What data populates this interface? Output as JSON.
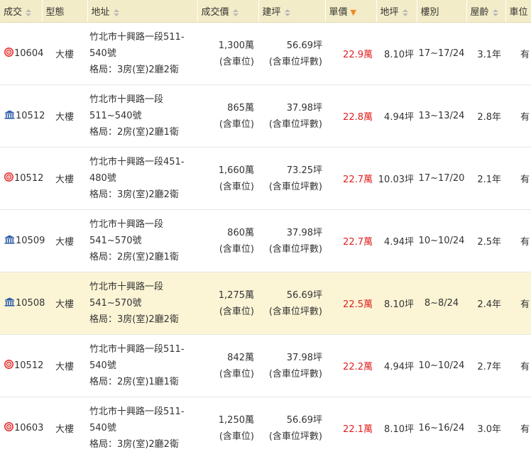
{
  "headers": {
    "date": "成交",
    "type": "型態",
    "addr": "地址",
    "price": "成交價",
    "area": "建坪",
    "unit": "單價",
    "land": "地坪",
    "floor": "樓別",
    "age": "屋齡",
    "parking": "車位"
  },
  "rows": [
    {
      "source": "target-icon",
      "date": "10604",
      "type": "大樓",
      "addr1": "竹北市十興路一段511-",
      "addr2": "540號",
      "layout": "格局：3房(室)2廳2衛",
      "price": "1,300萬",
      "price_note": "(含車位)",
      "area": "56.69坪",
      "area_note": "(含車位坪數)",
      "unit": "22.9萬",
      "land": "8.10坪",
      "floor": "17~17/24",
      "age": "3.1年",
      "parking": "有",
      "highlight": false
    },
    {
      "source": "government-icon",
      "date": "10512",
      "type": "大樓",
      "addr1": "竹北市十興路一段",
      "addr2": "511~540號",
      "layout": "格局：2房(室)2廳1衛",
      "price": "865萬",
      "price_note": "(含車位)",
      "area": "37.98坪",
      "area_note": "(含車位坪數)",
      "unit": "22.8萬",
      "land": "4.94坪",
      "floor": "13~13/24",
      "age": "2.8年",
      "parking": "有",
      "highlight": false
    },
    {
      "source": "target-icon",
      "date": "10512",
      "type": "大樓",
      "addr1": "竹北市十興路一段451-",
      "addr2": "480號",
      "layout": "格局：3房(室)2廳2衛",
      "price": "1,660萬",
      "price_note": "(含車位)",
      "area": "73.25坪",
      "area_note": "(含車位坪數)",
      "unit": "22.7萬",
      "land": "10.03坪",
      "floor": "17~17/20",
      "age": "2.1年",
      "parking": "有",
      "highlight": false
    },
    {
      "source": "government-icon",
      "date": "10509",
      "type": "大樓",
      "addr1": "竹北市十興路一段",
      "addr2": "541~570號",
      "layout": "格局：2房(室)2廳1衛",
      "price": "860萬",
      "price_note": "(含車位)",
      "area": "37.98坪",
      "area_note": "(含車位坪數)",
      "unit": "22.7萬",
      "land": "4.94坪",
      "floor": "10~10/24",
      "age": "2.5年",
      "parking": "有",
      "highlight": false
    },
    {
      "source": "government-icon",
      "date": "10508",
      "type": "大樓",
      "addr1": "竹北市十興路一段",
      "addr2": "541~570號",
      "layout": "格局：3房(室)2廳2衛",
      "price": "1,275萬",
      "price_note": "(含車位)",
      "area": "56.69坪",
      "area_note": "(含車位坪數)",
      "unit": "22.5萬",
      "land": "8.10坪",
      "floor": "8~8/24",
      "age": "2.4年",
      "parking": "有",
      "highlight": true
    },
    {
      "source": "target-icon",
      "date": "10512",
      "type": "大樓",
      "addr1": "竹北市十興路一段511-",
      "addr2": "540號",
      "layout": "格局：2房(室)1廳1衛",
      "price": "842萬",
      "price_note": "(含車位)",
      "area": "37.98坪",
      "area_note": "(含車位坪數)",
      "unit": "22.2萬",
      "land": "4.94坪",
      "floor": "10~10/24",
      "age": "2.7年",
      "parking": "有",
      "highlight": false
    },
    {
      "source": "target-icon",
      "date": "10603",
      "type": "大樓",
      "addr1": "竹北市十興路一段511-",
      "addr2": "540號",
      "layout": "格局：3房(室)2廳2衛",
      "price": "1,250萬",
      "price_note": "(含車位)",
      "area": "56.69坪",
      "area_note": "(含車位坪數)",
      "unit": "22.1萬",
      "land": "8.10坪",
      "floor": "16~16/24",
      "age": "3.0年",
      "parking": "有",
      "highlight": false
    }
  ],
  "colors": {
    "header_bg": "#f3ecc8",
    "highlight_bg": "#fbf5d6",
    "unit_price": "#e02020",
    "target_icon": "#e53030",
    "government_icon": "#2b5aa8"
  }
}
